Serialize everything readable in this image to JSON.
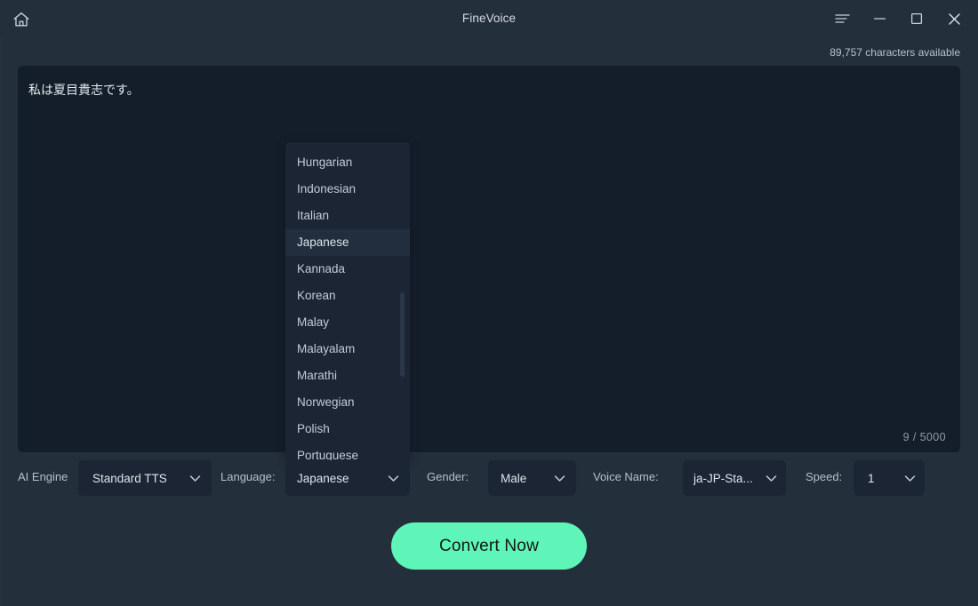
{
  "window": {
    "title": "FineVoice",
    "home_icon": "home-icon",
    "menu_icon": "hamburger-menu-icon",
    "minimize_icon": "minimize-icon",
    "maximize_icon": "maximize-icon",
    "close_icon": "close-icon"
  },
  "header": {
    "characters_available": "89,757 characters available"
  },
  "editor": {
    "text": "私は夏目貴志です。",
    "counter": "9 / 5000"
  },
  "language_popup": {
    "items": [
      {
        "label": "Hungarian",
        "selected": false
      },
      {
        "label": "Indonesian",
        "selected": false
      },
      {
        "label": "Italian",
        "selected": false
      },
      {
        "label": "Japanese",
        "selected": true
      },
      {
        "label": "Kannada",
        "selected": false
      },
      {
        "label": "Korean",
        "selected": false
      },
      {
        "label": "Malay",
        "selected": false
      },
      {
        "label": "Malayalam",
        "selected": false
      },
      {
        "label": "Marathi",
        "selected": false
      },
      {
        "label": "Norwegian",
        "selected": false
      },
      {
        "label": "Polish",
        "selected": false
      },
      {
        "label": "Portuguese",
        "selected": false
      }
    ]
  },
  "controls": {
    "engine_label": "AI Engine",
    "engine_value": "Standard TTS",
    "language_label": "Language:",
    "language_value": "Japanese",
    "gender_label": "Gender:",
    "gender_value": "Male",
    "voice_label": "Voice Name:",
    "voice_value": "ja-JP-Sta...",
    "speed_label": "Speed:",
    "speed_value": "1"
  },
  "actions": {
    "convert_label": "Convert Now"
  },
  "colors": {
    "page_background": "#242f3c",
    "panel_background": "#141e2b",
    "control_background": "#1b2533",
    "popup_background": "#1b2533",
    "popup_selected": "#222e3e",
    "accent_green": "#5ff5b8",
    "text_primary": "#dde4ec",
    "text_muted": "#8e9aa8"
  }
}
